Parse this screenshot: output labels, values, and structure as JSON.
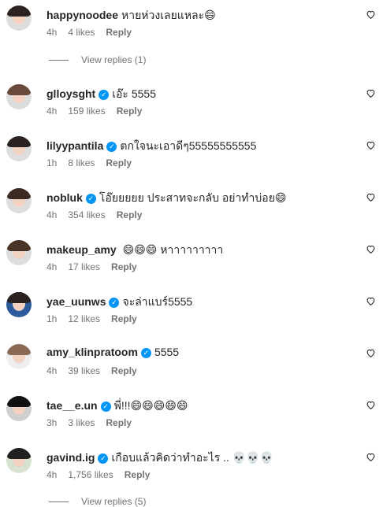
{
  "comments": [
    {
      "user": "happynoodee",
      "verified": false,
      "text": "หายห่วงเลยแหละ😄",
      "time": "4h",
      "likes": "4 likes",
      "reply": "Reply"
    },
    {
      "user": "glloysght",
      "verified": true,
      "text": "เอ๊ะ 5555",
      "time": "4h",
      "likes": "159 likes",
      "reply": "Reply"
    },
    {
      "user": "lilyypantila",
      "verified": true,
      "text": "ตกใจนะเอาดีๆ55555555555",
      "time": "1h",
      "likes": "8 likes",
      "reply": "Reply"
    },
    {
      "user": "nobluk",
      "verified": true,
      "text": "โอ๊ยยยยย ประสาทจะกลับ อย่าทำบ่อย😄",
      "time": "4h",
      "likes": "354 likes",
      "reply": "Reply"
    },
    {
      "user": "makeup_amy",
      "verified": false,
      "text": "😄😄😄 หาาาาาาาาา",
      "time": "4h",
      "likes": "17 likes",
      "reply": "Reply"
    },
    {
      "user": "yae_uunws",
      "verified": true,
      "text": "จะล่าแบร์5555",
      "time": "1h",
      "likes": "12 likes",
      "reply": "Reply"
    },
    {
      "user": "amy_klinpratoom",
      "verified": true,
      "text": "5555",
      "time": "4h",
      "likes": "39 likes",
      "reply": "Reply"
    },
    {
      "user": "tae__e.un",
      "verified": true,
      "text": "พี่!!!😄😄😄😄😄",
      "time": "3h",
      "likes": "3 likes",
      "reply": "Reply"
    },
    {
      "user": "gavind.ig",
      "verified": true,
      "text": "เกือบแล้วคิดว่าทำอะไร .. 💀💀💀",
      "time": "4h",
      "likes": "1,756 likes",
      "reply": "Reply"
    }
  ],
  "view_replies_1": "View replies (1)",
  "view_replies_2": "View replies (5)",
  "colors": {
    "verified": "#0095f6",
    "muted": "#737373",
    "text": "#262626"
  }
}
